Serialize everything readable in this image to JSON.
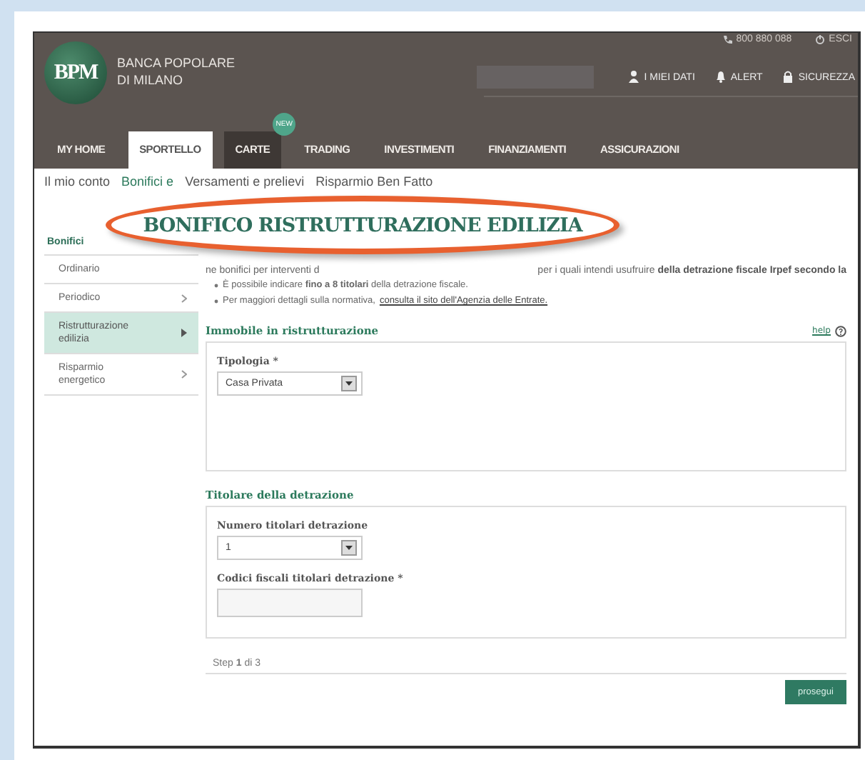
{
  "header": {
    "logo": "BPM",
    "bank_name": [
      "BANCA POPOLARE",
      "DI MILANO"
    ],
    "phone": "800 880 088",
    "logout": "ESCI",
    "links": [
      {
        "label": "I MIEI DATI",
        "kind": "person"
      },
      {
        "label": "ALERT",
        "kind": "bell"
      },
      {
        "label": "SICUREZZA",
        "kind": "lock"
      }
    ]
  },
  "nav": [
    {
      "label": "MY HOME",
      "selected": false,
      "highlighted": false
    },
    {
      "label": "SPORTELLO",
      "selected": true,
      "highlighted": false
    },
    {
      "label": "CARTE",
      "selected": false,
      "highlighted": true,
      "badge": "NEW"
    },
    {
      "label": "TRADING",
      "selected": false,
      "highlighted": false
    },
    {
      "label": "INVESTIMENTI",
      "selected": false,
      "highlighted": false
    },
    {
      "label": "FINANZIAMENTI",
      "selected": false,
      "highlighted": false
    },
    {
      "label": "ASSICURAZIONI",
      "selected": false,
      "highlighted": false
    }
  ],
  "breadcrumb": [
    {
      "label": "Il mio conto",
      "selected": false
    },
    {
      "label": "Bonifici e",
      "selected": true
    },
    {
      "label": "Versamenti e prelievi",
      "selected": false
    },
    {
      "label": "Risparmio Ben Fatto",
      "selected": false
    }
  ],
  "sidebar": {
    "title": "Bonifici",
    "items": [
      {
        "label": "Ordinario",
        "selected": false,
        "expandable": false
      },
      {
        "label": "Periodico",
        "selected": false,
        "expandable": true
      },
      {
        "label": "Ristrutturazione edilizia",
        "selected": true,
        "expandable": true
      },
      {
        "label": "Risparmio energetico",
        "selected": false,
        "expandable": true
      }
    ]
  },
  "callout_title": "BONIFICO RISTRUTTURAZIONE EDILIZIA",
  "intro": {
    "first_line": "ne bonifici per interventi d",
    "second_part": "per i quali intendi usufruire **della detrazione fiscale Irpef secondo la**",
    "bullets": [
      {
        "text": "È possibile indicare **fino a 8 titolari** della detrazione fiscale."
      },
      {
        "text": "Per maggiori dettagli sulla normativa,",
        "link": "consulta il sito dell'Agenzia delle Entrate."
      }
    ]
  },
  "sections": [
    {
      "title": "Immobile in ristrutturazione",
      "help": "help",
      "fields": [
        {
          "label": "Tipologia *",
          "kind": "select",
          "value": "Casa Privata"
        }
      ]
    },
    {
      "title": "Titolare della detrazione",
      "fields": [
        {
          "label": "Numero titolari detrazione",
          "kind": "select",
          "value": "1"
        },
        {
          "label": "Codici fiscali titolari detrazione *",
          "kind": "text"
        }
      ]
    }
  ],
  "step": "Step **1** di 3",
  "button": "prosegui"
}
